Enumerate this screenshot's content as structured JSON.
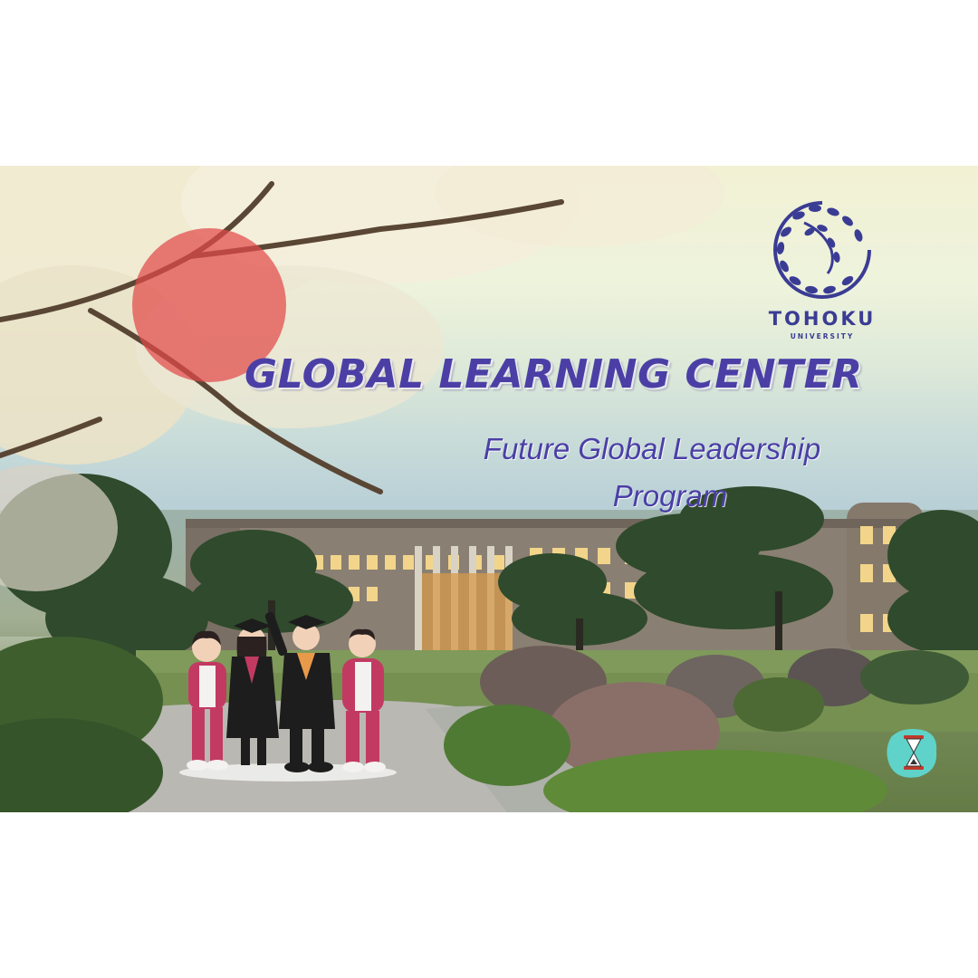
{
  "logo": {
    "name": "TOHOKU",
    "sub": "UNIVERSITY",
    "icon": "leaf-wreath-icon",
    "color": "#3a3c94"
  },
  "banner": {
    "title": "GLOBAL LEARNING CENTER",
    "subtitle_line1": "Future Global Leadership",
    "subtitle_line2": "Program",
    "accent": "#4b3fa6",
    "sun_color": "#e24a4a"
  },
  "icons": {
    "people": "graduates-illustration",
    "timer": "hourglass-icon",
    "sun": "red-sun-circle"
  }
}
